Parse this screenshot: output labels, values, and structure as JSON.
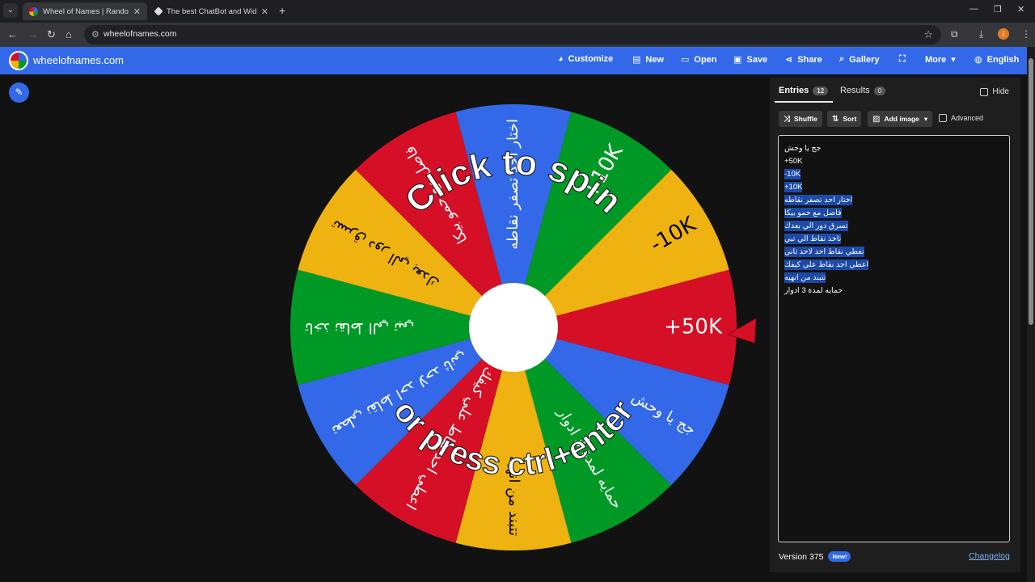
{
  "browser": {
    "tabs": [
      {
        "title": "Wheel of Names | Random nam",
        "active": true
      },
      {
        "title": "The best ChatBot and Widgets",
        "active": false
      }
    ],
    "url": "wheelofnames.com",
    "profile_initial": "I"
  },
  "app": {
    "brand": "wheelofnames.com",
    "menu": [
      {
        "label": "Customize",
        "icon": "palette-icon"
      },
      {
        "label": "New",
        "icon": "document-icon"
      },
      {
        "label": "Open",
        "icon": "folder-icon"
      },
      {
        "label": "Save",
        "icon": "save-icon"
      },
      {
        "label": "Share",
        "icon": "share-icon"
      },
      {
        "label": "Gallery",
        "icon": "search-icon"
      },
      {
        "label": "",
        "icon": "fullscreen-icon"
      },
      {
        "label": "More",
        "icon": "chevron-down-icon"
      },
      {
        "label": "English",
        "icon": "globe-icon"
      }
    ]
  },
  "wheel": {
    "overlay_top": "Click to spin",
    "overlay_bottom": "or press ctrl+enter",
    "colors": [
      "#d50f25",
      "#3369e8",
      "#009925",
      "#eeb211"
    ],
    "segments": [
      "+50K",
      "جج يا وحش",
      "حمايه لمدة 3 ادوار",
      "تتبند من انهيه",
      "اعطي احد نقاط علي كيفك",
      "تعطي نقاط احد لاحد ثاني",
      "تاخذ نقاط الي تبي",
      "تسرق دور الي بعدك",
      "فاصل مع حمو بيكا",
      "اختار احد تصفر نقاطه",
      "+10K",
      "-10K"
    ]
  },
  "panel": {
    "entries_tab": "Entries",
    "entries_count": "12",
    "results_tab": "Results",
    "results_count": "0",
    "hide_label": "Hide",
    "buttons": {
      "shuffle": "Shuffle",
      "sort": "Sort",
      "add_image": "Add image"
    },
    "advanced_label": "Advanced",
    "entries": [
      "جج يا وحش",
      "+50K",
      "-10K",
      "+10K",
      "اختار احد تصفر نقاطه",
      "فاصل مع حمو بيكا",
      "تسرق دور الي بعدك",
      "تاخذ نقاط الي تبي",
      "تعطي نقاط احد لاحد ثاني",
      "اعطي احد نقاط علي كيفك",
      "تتبند من انهيه",
      "حمايه لمدة 3 ادوار"
    ],
    "version": "Version 375",
    "new_badge": "New!",
    "changelog": "Changelog"
  }
}
